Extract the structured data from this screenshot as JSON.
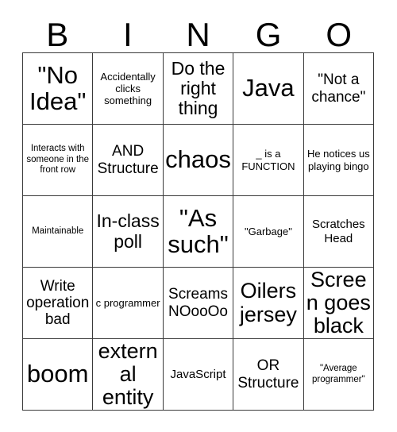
{
  "card": {
    "header_letters": [
      "B",
      "I",
      "N",
      "G",
      "O"
    ],
    "rows": [
      [
        {
          "text": "\"No Idea\"",
          "size": "xxl"
        },
        {
          "text": "Accidentally clicks something",
          "size": "xs"
        },
        {
          "text": "Do the right thing",
          "size": "lg"
        },
        {
          "text": "Java",
          "size": "xxl"
        },
        {
          "text": "\"Not a chance\"",
          "size": "md"
        }
      ],
      [
        {
          "text": "Interacts with someone in the front row",
          "size": "xxs"
        },
        {
          "text": "AND Structure",
          "size": "md"
        },
        {
          "text": "chaos",
          "size": "xxl"
        },
        {
          "text": "_ is a FUNCTION",
          "size": "xs"
        },
        {
          "text": "He notices us playing bingo",
          "size": "xs"
        }
      ],
      [
        {
          "text": "Maintainable",
          "size": "xxs"
        },
        {
          "text": "In-class poll",
          "size": "lg"
        },
        {
          "text": "\"As such\"",
          "size": "xxl"
        },
        {
          "text": "\"Garbage\"",
          "size": "xs"
        },
        {
          "text": "Scratches Head",
          "size": "sm"
        }
      ],
      [
        {
          "text": "Write operation bad",
          "size": "md"
        },
        {
          "text": "c programmer",
          "size": "xs"
        },
        {
          "text": "Screams NOooOo",
          "size": "md"
        },
        {
          "text": "Oilers jersey",
          "size": "xl"
        },
        {
          "text": "Screen goes black",
          "size": "xl"
        }
      ],
      [
        {
          "text": "boom",
          "size": "xxl"
        },
        {
          "text": "external entity",
          "size": "xl"
        },
        {
          "text": "JavaScript",
          "size": "sm"
        },
        {
          "text": "OR Structure",
          "size": "md"
        },
        {
          "text": "\"Average programmer\"",
          "size": "xxs"
        }
      ]
    ]
  },
  "colors": {
    "background": "#ffffff",
    "text": "#000000",
    "grid_line": "#3a3a3a"
  }
}
